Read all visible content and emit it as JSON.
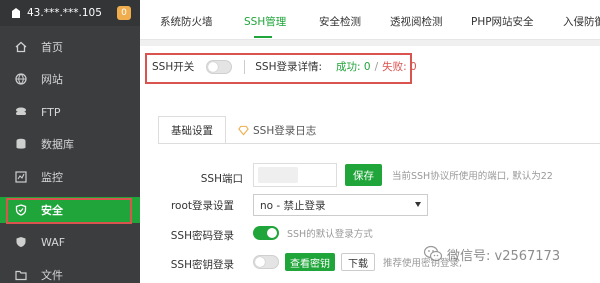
{
  "sidebar": {
    "server": "43.***.***.105",
    "badge": "0",
    "items": [
      {
        "label": "首页",
        "icon": "home-icon"
      },
      {
        "label": "网站",
        "icon": "globe-icon"
      },
      {
        "label": "FTP",
        "icon": "ftp-icon"
      },
      {
        "label": "数据库",
        "icon": "database-icon"
      },
      {
        "label": "监控",
        "icon": "monitor-icon"
      },
      {
        "label": "安全",
        "icon": "shield-icon",
        "active": true
      },
      {
        "label": "WAF",
        "icon": "waf-shield-icon"
      },
      {
        "label": "文件",
        "icon": "folder-icon"
      }
    ]
  },
  "top_tabs": [
    "系统防火墙",
    "SSH管理",
    "安全检测",
    "透视阅检测",
    "PHP网站安全",
    "入侵防御"
  ],
  "active_top_tab": "SSH管理",
  "ssh_bar": {
    "switch_label": "SSH开关",
    "details_label": "SSH登录详情:",
    "success": "成功: 0",
    "separator": "/",
    "fail": "失败: 0"
  },
  "sub_tabs": {
    "basic": "基础设置",
    "log": "SSH登录日志"
  },
  "form": {
    "port_label": "SSH端口",
    "save_button": "保存",
    "port_hint": "当前SSH协议所使用的端口, 默认为22",
    "root_label": "root登录设置",
    "root_value": "no - 禁止登录",
    "pwd_label": "SSH密码登录",
    "pwd_hint": "SSH的默认登录方式",
    "key_label": "SSH密钥登录",
    "view_key_button": "查看密钥",
    "download_button": "下载",
    "key_hint": "推荐使用密钥登录,"
  },
  "watermark": "微信号: v2567173",
  "colors": {
    "accent": "#20a53a",
    "highlight": "#d9534f",
    "sidebar_bg": "#3b3d3f",
    "badge": "#f0ad4e"
  }
}
